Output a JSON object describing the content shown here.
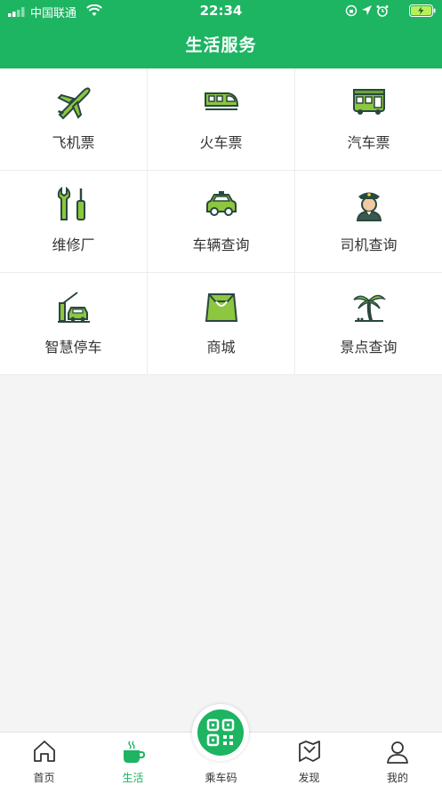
{
  "status_bar": {
    "carrier": "中国联通",
    "time": "22:34"
  },
  "header": {
    "title": "生活服务"
  },
  "services": [
    {
      "label": "飞机票",
      "icon": "airplane-icon"
    },
    {
      "label": "火车票",
      "icon": "train-icon"
    },
    {
      "label": "汽车票",
      "icon": "bus-icon"
    },
    {
      "label": "维修厂",
      "icon": "wrench-screwdriver-icon"
    },
    {
      "label": "车辆查询",
      "icon": "car-icon"
    },
    {
      "label": "司机查询",
      "icon": "driver-icon"
    },
    {
      "label": "智慧停车",
      "icon": "parking-gate-icon"
    },
    {
      "label": "商城",
      "icon": "shopping-bag-icon"
    },
    {
      "label": "景点查询",
      "icon": "palm-tree-icon"
    }
  ],
  "tabbar": {
    "items": [
      {
        "label": "首页",
        "icon": "home-icon"
      },
      {
        "label": "生活",
        "icon": "coffee-cup-icon",
        "active": true
      },
      {
        "label": "乘车码",
        "icon": "qr-code-icon"
      },
      {
        "label": "发现",
        "icon": "discover-icon"
      },
      {
        "label": "我的",
        "icon": "user-icon"
      }
    ]
  },
  "colors": {
    "brand": "#1db462",
    "icon_fill": "#8dc63f",
    "icon_dark": "#29483f"
  }
}
